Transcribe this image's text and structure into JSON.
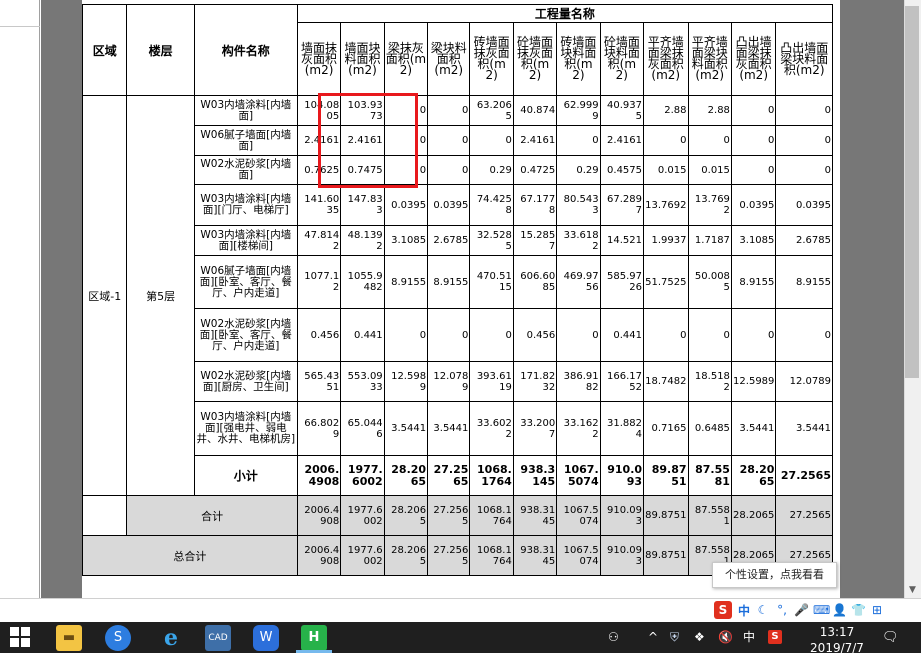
{
  "table": {
    "group_header": "工程量名称",
    "col_region": "区域",
    "col_floor": "楼层",
    "col_component": "构件名称",
    "columns": [
      "墙面抹灰面积(m2)",
      "墙面块料面积(m2)",
      "梁抹灰面积(m2)",
      "梁块料面积(m2)",
      "砖墙面抹灰面积(m2)",
      "砼墙面抹灰面积(m2)",
      "砖墙面块料面积(m2)",
      "砼墙面块料面积(m2)",
      "平齐墙面梁抹灰面积(m2)",
      "平齐墙面梁块料面积(m2)",
      "凸出墙面梁抹灰面积(m2)",
      "凸出墙面梁块料面积(m2)"
    ],
    "region": "区域-1",
    "floor": "第5层",
    "rows": [
      {
        "name": "W03内墙涂料[内墙面]",
        "values": [
          "104.0805",
          "103.9373",
          "0",
          "0",
          "63.2065",
          "40.874",
          "62.9999",
          "40.9375",
          "2.88",
          "2.88",
          "0",
          "0"
        ]
      },
      {
        "name": "W06腻子墙面[内墙面]",
        "values": [
          "2.4161",
          "2.4161",
          "0",
          "0",
          "0",
          "2.4161",
          "0",
          "2.4161",
          "0",
          "0",
          "0",
          "0"
        ]
      },
      {
        "name": "W02水泥砂浆[内墙面]",
        "values": [
          "0.7625",
          "0.7475",
          "0",
          "0",
          "0.29",
          "0.4725",
          "0.29",
          "0.4575",
          "0.015",
          "0.015",
          "0",
          "0"
        ]
      },
      {
        "name": "W03内墙涂料[内墙面][门厅、电梯厅]",
        "values": [
          "141.6035",
          "147.833",
          "0.0395",
          "0.0395",
          "74.4258",
          "67.1778",
          "80.5433",
          "67.2897",
          "13.7692",
          "13.7692",
          "0.0395",
          "0.0395"
        ]
      },
      {
        "name": "W03内墙涂料[内墙面][楼梯间]",
        "values": [
          "47.8142",
          "48.1392",
          "3.1085",
          "2.6785",
          "32.5285",
          "15.2857",
          "33.6182",
          "14.521",
          "1.9937",
          "1.7187",
          "3.1085",
          "2.6785"
        ]
      },
      {
        "name": "W06腻子墙面[内墙面][卧室、客厅、餐厅、户内走道]",
        "values": [
          "1077.12",
          "1055.9482",
          "8.9155",
          "8.9155",
          "470.5115",
          "606.6085",
          "469.9756",
          "585.9726",
          "51.7525",
          "50.0085",
          "8.9155",
          "8.9155"
        ]
      },
      {
        "name": "W02水泥砂浆[内墙面][卧室、客厅、餐厅、户内走道]",
        "values": [
          "0.456",
          "0.441",
          "0",
          "0",
          "0",
          "0.456",
          "0",
          "0.441",
          "0",
          "0",
          "0",
          "0"
        ]
      },
      {
        "name": "W02水泥砂浆[内墙面][厨房、卫生间]",
        "values": [
          "565.4351",
          "553.0933",
          "12.5989",
          "12.0789",
          "393.6119",
          "171.8232",
          "386.9182",
          "166.1752",
          "18.7482",
          "18.5182",
          "12.5989",
          "12.0789"
        ]
      },
      {
        "name": "W03内墙涂料[内墙面][强电井、弱电井、水井、电梯机房]",
        "values": [
          "66.8029",
          "65.0446",
          "3.5441",
          "3.5441",
          "33.6022",
          "33.2007",
          "33.1622",
          "31.8824",
          "0.7165",
          "0.6485",
          "3.5441",
          "3.5441"
        ]
      }
    ],
    "subtotal": {
      "label": "小计",
      "values": [
        "2006.4908",
        "1977.6002",
        "28.2065",
        "27.2565",
        "1068.1764",
        "938.3145",
        "1067.5074",
        "910.093",
        "89.8751",
        "87.5581",
        "28.2065",
        "27.2565"
      ]
    },
    "total": {
      "label": "合计",
      "values": [
        "2006.4908",
        "1977.6002",
        "28.2065",
        "27.2565",
        "1068.1764",
        "938.3145",
        "1067.5074",
        "910.093",
        "89.8751",
        "87.5581",
        "28.2065",
        "27.2565"
      ]
    },
    "grand_total": {
      "label": "总合计",
      "values": [
        "2006.4908",
        "1977.6002",
        "28.2065",
        "27.2565",
        "1068.1764",
        "938.3145",
        "1067.5074",
        "910.093",
        "89.8751",
        "87.5581",
        "28.2065",
        "27.2565"
      ]
    }
  },
  "tooltip": {
    "text": "个性设置，点我看看"
  },
  "ime": {
    "logo": "S",
    "mode": "中",
    "items": [
      "moon-icon",
      "punctuation-icon",
      "mic-icon",
      "keyboard-icon",
      "user-icon",
      "shirt-icon",
      "grid-icon"
    ]
  },
  "taskbar": {
    "cad_label": "CAD",
    "green_label": "H",
    "tray_lang": "中",
    "tray_s": "S",
    "clock_time": "13:17",
    "clock_date": "2019/7/7"
  },
  "colors": {
    "highlight": "#e8181c",
    "taskbar": "#1f1f1f",
    "gutter": "#777777",
    "gray_row": "#d9d9d9"
  }
}
